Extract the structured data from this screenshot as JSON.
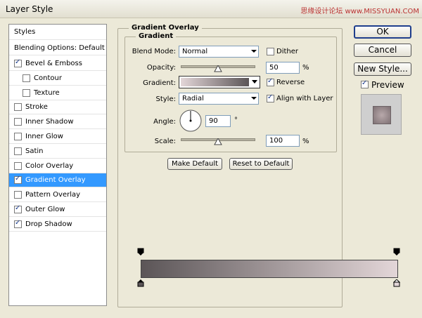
{
  "window": {
    "title": "Layer Style",
    "watermark": "思缘设计论坛 www.MISSYUAN.COM"
  },
  "styles_panel": {
    "header": "Styles",
    "blending": "Blending Options: Default",
    "items": [
      {
        "label": "Bevel & Emboss",
        "checked": true,
        "indent": false,
        "selected": false
      },
      {
        "label": "Contour",
        "checked": false,
        "indent": true,
        "selected": false
      },
      {
        "label": "Texture",
        "checked": false,
        "indent": true,
        "selected": false
      },
      {
        "label": "Stroke",
        "checked": false,
        "indent": false,
        "selected": false
      },
      {
        "label": "Inner Shadow",
        "checked": false,
        "indent": false,
        "selected": false
      },
      {
        "label": "Inner Glow",
        "checked": false,
        "indent": false,
        "selected": false
      },
      {
        "label": "Satin",
        "checked": false,
        "indent": false,
        "selected": false
      },
      {
        "label": "Color Overlay",
        "checked": false,
        "indent": false,
        "selected": false
      },
      {
        "label": "Gradient Overlay",
        "checked": true,
        "indent": false,
        "selected": true
      },
      {
        "label": "Pattern Overlay",
        "checked": false,
        "indent": false,
        "selected": false
      },
      {
        "label": "Outer Glow",
        "checked": true,
        "indent": false,
        "selected": false
      },
      {
        "label": "Drop Shadow",
        "checked": true,
        "indent": false,
        "selected": false
      }
    ]
  },
  "gradient_overlay": {
    "group_title": "Gradient Overlay",
    "sub_title": "Gradient",
    "blend_mode_label": "Blend Mode:",
    "blend_mode": "Normal",
    "dither_label": "Dither",
    "dither": false,
    "opacity_label": "Opacity:",
    "opacity": "50",
    "opacity_fraction": 0.5,
    "percent": "%",
    "gradient_label": "Gradient:",
    "reverse_label": "Reverse",
    "reverse": true,
    "style_label": "Style:",
    "style": "Radial",
    "align_label": "Align with Layer",
    "align": true,
    "angle_label": "Angle:",
    "angle": "90",
    "degree": "°",
    "scale_label": "Scale:",
    "scale": "100",
    "scale_fraction": 0.5,
    "make_default": "Make Default",
    "reset_default": "Reset to Default"
  },
  "buttons": {
    "ok": "OK",
    "cancel": "Cancel",
    "new_style": "New Style...",
    "preview_label": "Preview",
    "preview": true
  },
  "colors": {
    "selected": "#3399ff",
    "gradient_start": "#5b5557",
    "gradient_end": "#e3d6d8"
  }
}
